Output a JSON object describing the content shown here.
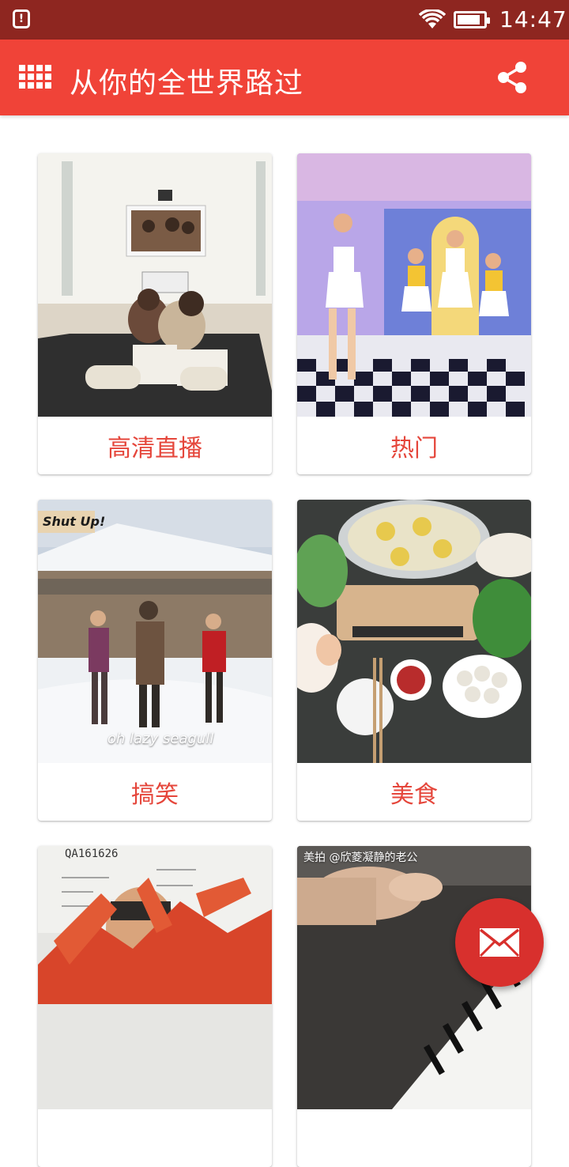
{
  "status_bar": {
    "time": "14:47",
    "alert_symbol": "!",
    "icons": [
      "alert-icon",
      "wifi-icon",
      "battery-icon"
    ]
  },
  "app_bar": {
    "title": "从你的全世界路过",
    "menu_icon": "grid-menu-icon",
    "share_icon": "share-icon",
    "background": "#f04338"
  },
  "categories": [
    {
      "label": "高清直播",
      "thumb": "family-watching-tv"
    },
    {
      "label": "热门",
      "thumb": "dancers-stage"
    },
    {
      "label": "搞笑",
      "thumb": "snowy-village-dance",
      "overlay_badge": "Shut Up!",
      "overlay_caption": "oh lazy seagull"
    },
    {
      "label": "美食",
      "thumb": "hotpot-table"
    },
    {
      "label": "",
      "thumb": "king-crab-vendor",
      "overlay_note": "QA161626"
    },
    {
      "label": "",
      "thumb": "piano-hands",
      "overlay_caption": "美拍 @欣菱凝静的老公"
    }
  ],
  "fab": {
    "icon": "mail-icon",
    "color": "#d8302d"
  },
  "accent_text_color": "#e5463b"
}
